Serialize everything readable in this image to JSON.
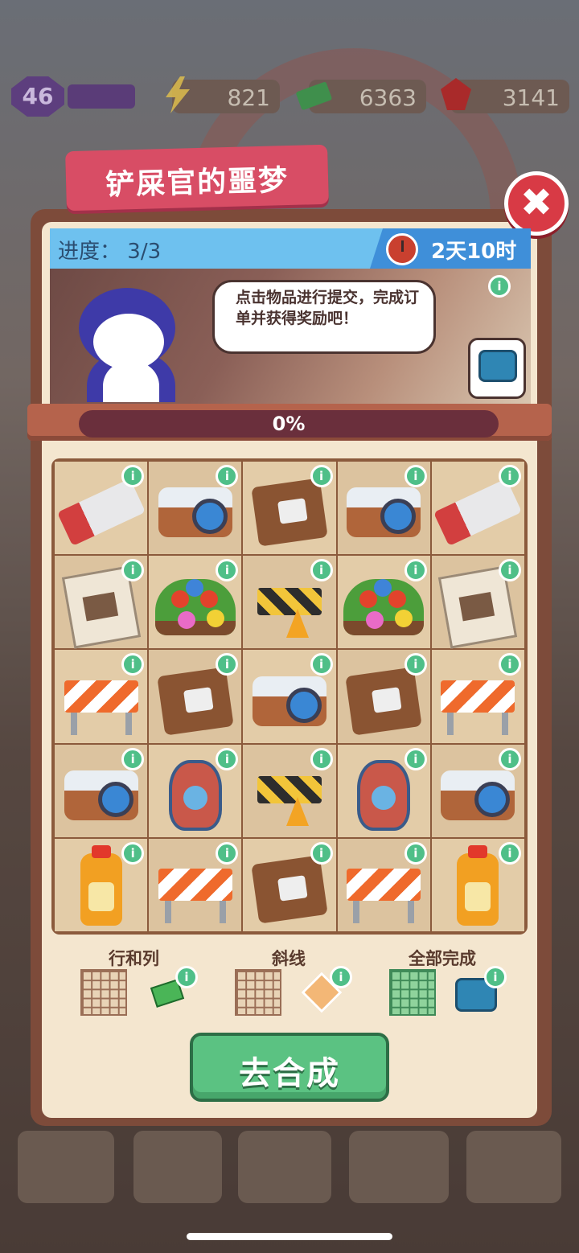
{
  "hud": {
    "level": "46",
    "energy": "821",
    "cash": "6363",
    "gems": "3141"
  },
  "event": {
    "title": "铲屎官的噩梦",
    "close_label": "✖",
    "progress_label": "进度：",
    "progress_value": "3/3",
    "timer": "2天10时",
    "speech": "点击物品进行提交，完成订单并获得奖励吧！",
    "percent": "0%"
  },
  "grid": [
    [
      "saw",
      "camera",
      "folder",
      "camera",
      "saw"
    ],
    [
      "poster",
      "flowers",
      "barrier",
      "flowers",
      "poster"
    ],
    [
      "roadblock",
      "folder",
      "camera",
      "folder",
      "roadblock"
    ],
    [
      "camera",
      "vase",
      "barrier",
      "vase",
      "camera"
    ],
    [
      "oil",
      "roadblock",
      "folder",
      "roadblock",
      "oil"
    ]
  ],
  "goals": {
    "rows_cols_label": "行和列",
    "diagonal_label": "斜线",
    "all_label": "全部完成"
  },
  "info_label": "i",
  "merge_button": "去合成",
  "colors": {
    "title_tab": "#d84d65",
    "merge_button": "#5bc282",
    "close": "#d83a45"
  }
}
